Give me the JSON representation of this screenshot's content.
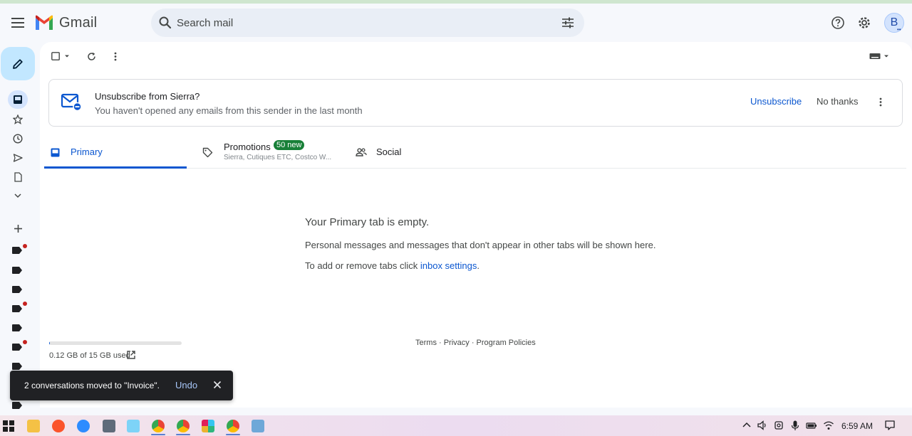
{
  "app": {
    "name": "Gmail"
  },
  "search": {
    "placeholder": "Search mail"
  },
  "account": {
    "initial": "B",
    "dots": "••"
  },
  "banner": {
    "title": "Unsubscribe from Sierra?",
    "subtitle": "You haven't opened any emails from this sender in the last month",
    "unsubscribe_label": "Unsubscribe",
    "no_thanks_label": "No thanks"
  },
  "tabs": [
    {
      "label": "Primary"
    },
    {
      "label": "Promotions",
      "badge": "50 new",
      "subtitle": "Sierra, Cutiques ETC, Costco W..."
    },
    {
      "label": "Social"
    }
  ],
  "empty_state": {
    "title": "Your Primary tab is empty.",
    "line1": "Personal messages and messages that don't appear in other tabs will be shown here.",
    "line2_prefix": "To add or remove tabs click ",
    "line2_link": "inbox settings",
    "line2_suffix": "."
  },
  "storage": {
    "text": "0.12 GB of 15 GB used",
    "used_fraction": 0.008
  },
  "footer": {
    "links": "Terms · Privacy · Program Policies"
  },
  "toast": {
    "message": "2 conversations moved to \"Invoice\".",
    "undo_label": "Undo"
  },
  "taskbar": {
    "time": "6:59 AM"
  },
  "colors": {
    "accent": "#0b57d0",
    "compose_bg": "#c2e7ff",
    "badge_green": "#188038",
    "label_dot": "#c5221f"
  }
}
